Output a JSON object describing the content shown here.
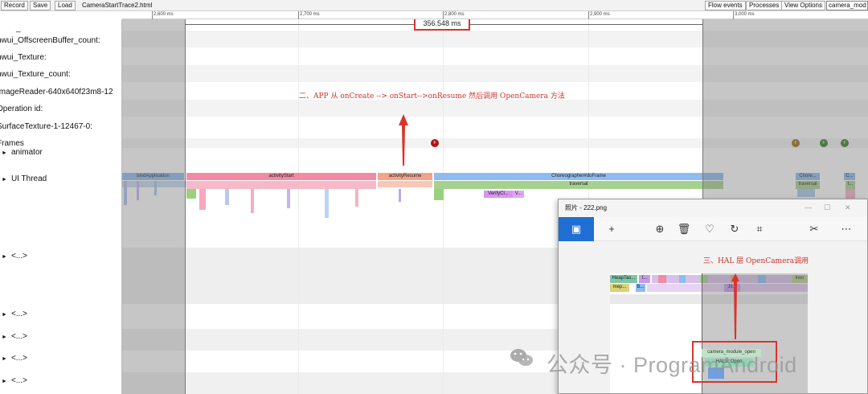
{
  "toolbar": {
    "record": "Record",
    "save": "Save",
    "load": "Load",
    "filename": "CameraStartTrace2.html",
    "flow_events": "Flow events",
    "processes": "Processes",
    "view_options": "View Options",
    "search_value": "camera_mod"
  },
  "ruler": {
    "ticks": [
      "2,600 ms",
      "2,700 ms",
      "2,800 ms",
      "2,900 ms",
      "3,000 ms"
    ]
  },
  "range": {
    "duration": "356.548 ms"
  },
  "rows": {
    "underscore": "_",
    "offscreen_buffer": "hwui_OffscreenBuffer_count:",
    "texture": "hwui_Texture:",
    "texture_count": "hwui_Texture_count:",
    "image_reader": "ImageReader-640x640f23m8-12",
    "operation_id": "Operation id:",
    "surface_texture": "SurfaceTexture-1-12467-0:",
    "frames": "Frames",
    "animator": "animator",
    "ui_thread": "UI Thread",
    "collapsed": "<...>"
  },
  "slices": {
    "bind_application": "bindApplication",
    "activity_start": "activityStart",
    "activity_resume": "activityResume",
    "choreographer": "Choreographer#doFrame",
    "traversal": "traversal",
    "verify": "VerifyCl...",
    "v": "V...",
    "chore_short": "Chore...",
    "traversal_short": "traversal",
    "c_short": "C...",
    "t_short": "t..."
  },
  "frame_dots": [
    "F",
    "F",
    "F",
    "F"
  ],
  "annotations": {
    "app_lifecycle": "二、APP 从 onCreate --> onStart-->onResume 然后调用 OpenCamera 方法",
    "hal_open": "三、HAL 层 OpenCamera调用"
  },
  "photo_window": {
    "title": "照片 - 222.png",
    "buttons": [
      "image-icon",
      "add-icon",
      "zoom-icon",
      "delete-icon",
      "heart-icon",
      "rotate-icon",
      "crop-icon",
      "edit-icon",
      "more-icon"
    ],
    "inner_labels": {
      "heap": "HeapTas...",
      "mep": "mep...",
      "i": "I...",
      "b": "B...",
      "jit": "Jit...",
      "kwo": "kwo",
      "camera_module": "camera_module_open",
      "hal3_open": "HAL3::Open"
    }
  },
  "watermark": "公众号 · ProgramAndroid",
  "colors": {
    "accent_red": "#d9342b",
    "photo_blue": "#1f6fd4",
    "slice_blue": "#8dbcf0",
    "slice_pink": "#f28aa5",
    "slice_green": "#a5d18f",
    "slice_salmon": "#f2a38a",
    "slice_purple": "#d995f2"
  }
}
